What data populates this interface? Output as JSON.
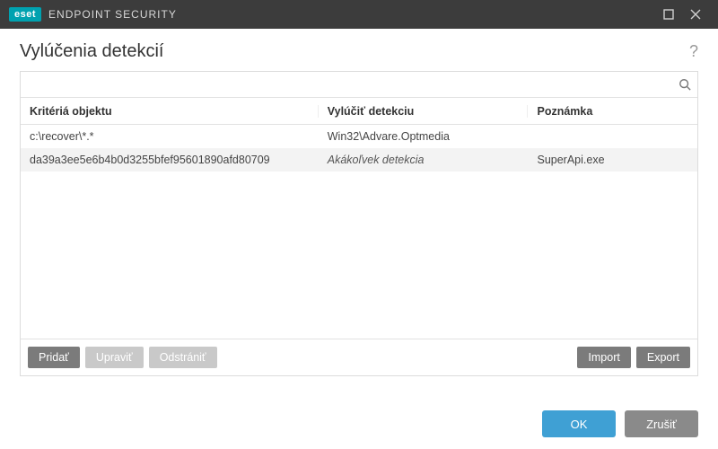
{
  "titlebar": {
    "brand_logo": "eset",
    "brand_text": "ENDPOINT SECURITY"
  },
  "header": {
    "title": "Vylúčenia detekcií",
    "help_tooltip": "?"
  },
  "search": {
    "placeholder": ""
  },
  "table": {
    "columns": {
      "criteria": "Kritériá objektu",
      "detection": "Vylúčiť detekciu",
      "note": "Poznámka"
    },
    "rows": [
      {
        "criteria": "c:\\recover\\*.*",
        "detection": "Win32\\Advare.Optmedia",
        "note": "",
        "detection_italic": false
      },
      {
        "criteria": "da39a3ee5e6b4b0d3255bfef95601890afd80709",
        "detection": "Akákoľvek detekcia",
        "note": "SuperApi.exe",
        "detection_italic": true
      }
    ]
  },
  "toolbar": {
    "add": "Pridať",
    "edit": "Upraviť",
    "delete": "Odstrániť",
    "import": "Import",
    "export": "Export"
  },
  "footer": {
    "ok": "OK",
    "cancel": "Zrušiť"
  }
}
